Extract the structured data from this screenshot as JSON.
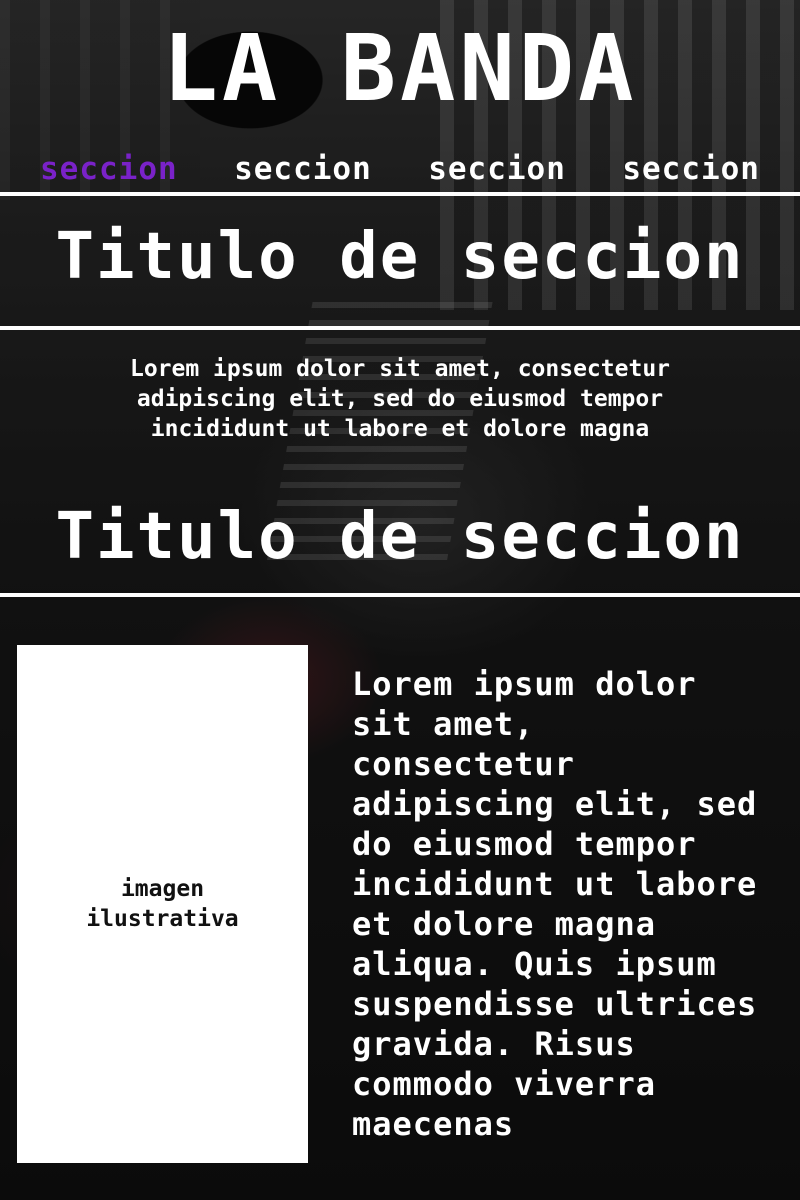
{
  "header": {
    "title": "LA BANDA"
  },
  "nav": {
    "items": [
      {
        "label": "seccion",
        "active": true
      },
      {
        "label": "seccion",
        "active": false
      },
      {
        "label": "seccion",
        "active": false
      },
      {
        "label": "seccion",
        "active": false
      }
    ]
  },
  "colors": {
    "accent": "#7a22c9",
    "text": "#ffffff",
    "rule": "#ffffff",
    "placeholder_bg": "#ffffff"
  },
  "section1": {
    "title": "Titulo de seccion",
    "text": "Lorem ipsum dolor sit amet, consectetur adipiscing elit, sed do eiusmod tempor incididunt ut labore et dolore magna"
  },
  "section2": {
    "title": "Titulo de seccion",
    "image_caption": "imagen ilustrativa",
    "text": "Lorem ipsum dolor sit amet, consectetur adipiscing elit, sed do eiusmod tempor incididunt ut labore et dolore magna aliqua. Quis ipsum suspendisse ultrices gravida. Risus commodo viverra maecenas"
  }
}
